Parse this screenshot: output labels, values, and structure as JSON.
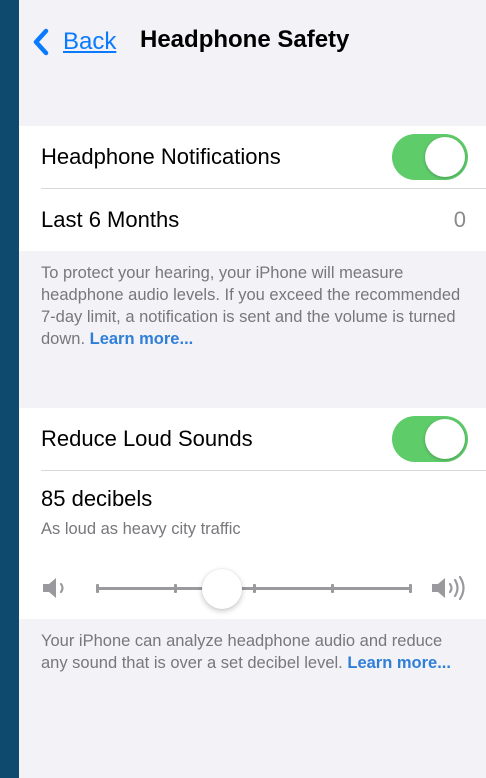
{
  "nav": {
    "back_label": "Back",
    "title": "Headphone Safety"
  },
  "notifications": {
    "toggle_label": "Headphone Notifications",
    "toggle_on": true,
    "last_label": "Last 6 Months",
    "last_value": "0",
    "footnote": "To protect your hearing, your iPhone will measure headphone audio levels. If you exceed the recommended 7-day limit, a notification is sent and the volume is turned down.",
    "learn_more": "Learn more..."
  },
  "reduce": {
    "toggle_label": "Reduce Loud Sounds",
    "toggle_on": true,
    "decibels": "85 decibels",
    "description": "As loud as heavy city traffic",
    "slider_level": 0.4,
    "slider_ticks": 5,
    "footnote": "Your iPhone can analyze headphone audio and reduce any sound that is over a set decibel level.",
    "learn_more": "Learn more..."
  },
  "colors": {
    "accent": "#0a7aff",
    "toggle_on": "#5fcc6a",
    "background": "#f2f2f7",
    "outer": "#0e4a6e"
  },
  "icons": [
    "back-chevron-icon",
    "speaker-low-icon",
    "speaker-high-icon"
  ]
}
